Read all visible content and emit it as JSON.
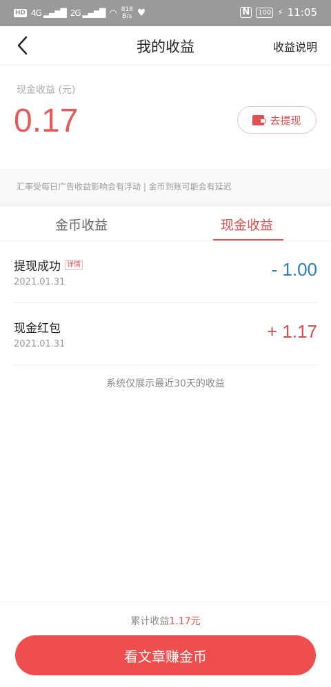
{
  "status_bar": {
    "hd": "HD",
    "signal1": "4G",
    "signal2": "2G",
    "net_speed_value": "818",
    "net_speed_unit": "B/s",
    "nfc": "N",
    "battery": "100",
    "time": "11:05"
  },
  "nav": {
    "title": "我的收益",
    "right_label": "收益说明"
  },
  "cash": {
    "label": "现金收益 (元)",
    "value": "0.17",
    "withdraw_label": "去提现"
  },
  "notice": "汇率受每日广告收益影响会有浮动 | 金币到账可能会有延迟",
  "tabs": [
    {
      "label": "金币收益",
      "active": false
    },
    {
      "label": "现金收益",
      "active": true
    }
  ],
  "records": [
    {
      "title": "提现成功",
      "tag": "详情",
      "date": "2021.01.31",
      "amount": "- 1.00"
    },
    {
      "title": "现金红包",
      "tag": "",
      "date": "2021.01.31",
      "amount": "+ 1.17"
    }
  ],
  "history_note": "系统仅展示最近30天的收益",
  "footer": {
    "total_label": "累计收益",
    "total_value": "1.17元",
    "cta_label": "看文章赚金币"
  },
  "colors": {
    "accent": "#e05050",
    "negative": "#2d7fb5",
    "positive": "#d04f4f",
    "cta": "#ef4e4e"
  }
}
